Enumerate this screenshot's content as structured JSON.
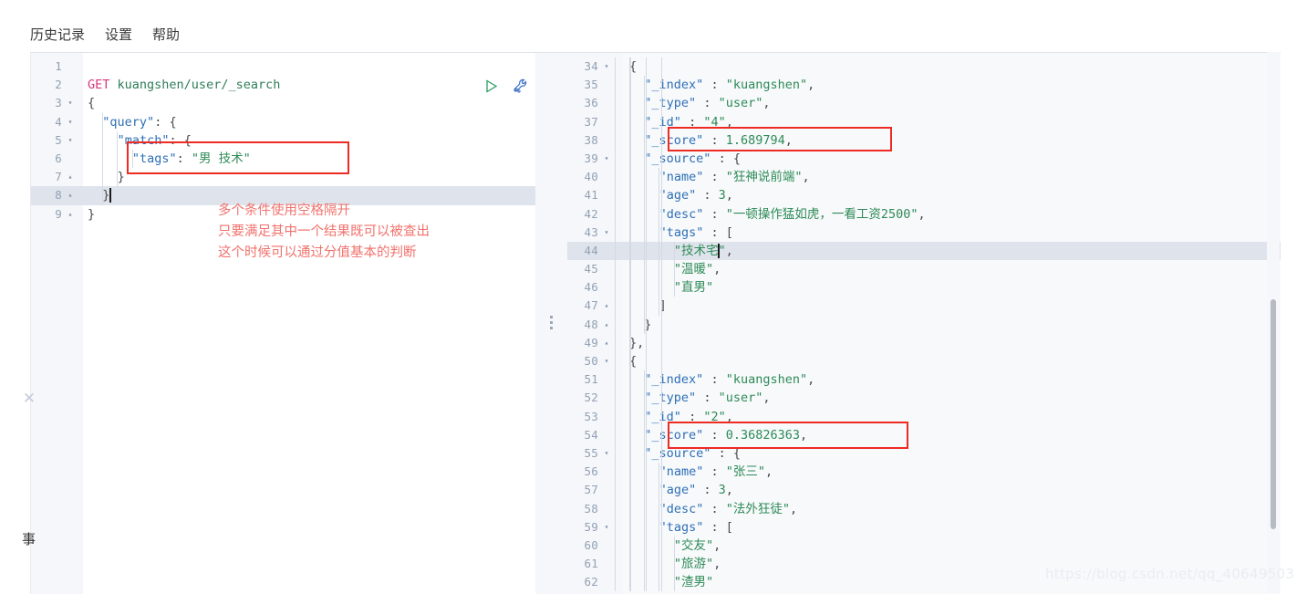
{
  "menubar": {
    "items": [
      {
        "label": "历史记录",
        "name": "menu-history"
      },
      {
        "label": "设置",
        "name": "menu-settings"
      },
      {
        "label": "帮助",
        "name": "menu-help"
      }
    ]
  },
  "toolbar": {
    "run_icon": "play-icon",
    "wrench_icon": "wrench-icon"
  },
  "left_editor": {
    "lines": [
      {
        "no": "1",
        "fold": "",
        "text": ""
      },
      {
        "no": "2",
        "fold": "",
        "text": "GET kuangshen/user/_search"
      },
      {
        "no": "3",
        "fold": "▾",
        "text": "{"
      },
      {
        "no": "4",
        "fold": "▾",
        "text": "  \"query\": {"
      },
      {
        "no": "5",
        "fold": "▾",
        "text": "    \"match\": {"
      },
      {
        "no": "6",
        "fold": "",
        "text": "      \"tags\": \"男 技术\""
      },
      {
        "no": "7",
        "fold": "▴",
        "text": "    }"
      },
      {
        "no": "8",
        "fold": "▴",
        "text": "  }"
      },
      {
        "no": "9",
        "fold": "▴",
        "text": "}"
      }
    ],
    "active_line": "8",
    "method": "GET",
    "url": "kuangshen/user/_search"
  },
  "annotations": {
    "notes": [
      "多个条件使用空格隔开",
      "只要满足其中一个结果既可以被查出",
      "这个时候可以通过分值基本的判断"
    ]
  },
  "right_editor": {
    "active_line": "44",
    "lines": [
      {
        "no": "34",
        "fold": "▾",
        "text": "{"
      },
      {
        "no": "35",
        "fold": "",
        "text": "  \"_index\" : \"kuangshen\","
      },
      {
        "no": "36",
        "fold": "",
        "text": "  \"_type\" : \"user\","
      },
      {
        "no": "37",
        "fold": "",
        "text": "  \"_id\" : \"4\","
      },
      {
        "no": "38",
        "fold": "",
        "text": "  \"_score\" : 1.689794,"
      },
      {
        "no": "39",
        "fold": "▾",
        "text": "  \"_source\" : {"
      },
      {
        "no": "40",
        "fold": "",
        "text": "    \"name\" : \"狂神说前端\","
      },
      {
        "no": "41",
        "fold": "",
        "text": "    \"age\" : 3,"
      },
      {
        "no": "42",
        "fold": "",
        "text": "    \"desc\" : \"一顿操作猛如虎，一看工资2500\","
      },
      {
        "no": "43",
        "fold": "▾",
        "text": "    \"tags\" : ["
      },
      {
        "no": "44",
        "fold": "",
        "text": "      \"技术宅\","
      },
      {
        "no": "45",
        "fold": "",
        "text": "      \"温暖\","
      },
      {
        "no": "46",
        "fold": "",
        "text": "      \"直男\""
      },
      {
        "no": "47",
        "fold": "▴",
        "text": "    ]"
      },
      {
        "no": "48",
        "fold": "▴",
        "text": "  }"
      },
      {
        "no": "49",
        "fold": "▴",
        "text": "},"
      },
      {
        "no": "50",
        "fold": "▾",
        "text": "{"
      },
      {
        "no": "51",
        "fold": "",
        "text": "  \"_index\" : \"kuangshen\","
      },
      {
        "no": "52",
        "fold": "",
        "text": "  \"_type\" : \"user\","
      },
      {
        "no": "53",
        "fold": "",
        "text": "  \"_id\" : \"2\","
      },
      {
        "no": "54",
        "fold": "",
        "text": "  \"_score\" : 0.36826363,"
      },
      {
        "no": "55",
        "fold": "▾",
        "text": "  \"_source\" : {"
      },
      {
        "no": "56",
        "fold": "",
        "text": "    \"name\" : \"张三\","
      },
      {
        "no": "57",
        "fold": "",
        "text": "    \"age\" : 3,"
      },
      {
        "no": "58",
        "fold": "",
        "text": "    \"desc\" : \"法外狂徒\","
      },
      {
        "no": "59",
        "fold": "▾",
        "text": "    \"tags\" : ["
      },
      {
        "no": "60",
        "fold": "",
        "text": "      \"交友\","
      },
      {
        "no": "61",
        "fold": "",
        "text": "      \"旅游\","
      },
      {
        "no": "62",
        "fold": "",
        "text": "      \"渣男\""
      }
    ],
    "highlighted_values": {
      "score_hit_1": "1.689794",
      "score_hit_2": "0.36826363"
    }
  },
  "rail": {
    "close_glyph": "✕",
    "side_char": "事"
  },
  "watermark": {
    "text": "https://blog.csdn.net/qq_40649503"
  },
  "colors": {
    "accent_red": "#ee2b23",
    "note_red": "#f1726c",
    "method": "#d9387b",
    "string": "#2e8b57",
    "key": "#2f6fb5",
    "active_line": "#dfe3ec"
  }
}
